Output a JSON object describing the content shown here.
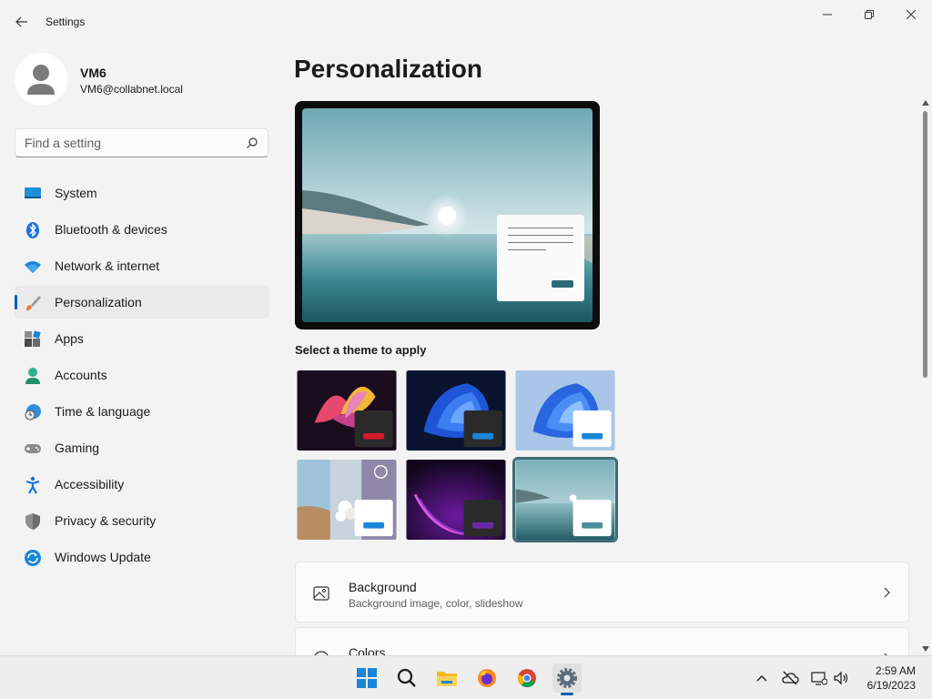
{
  "window": {
    "app_title": "Settings"
  },
  "profile": {
    "name": "VM6",
    "email": "VM6@collabnet.local"
  },
  "search": {
    "placeholder": "Find a setting"
  },
  "nav": {
    "items": [
      {
        "label": "System",
        "icon": "system-icon"
      },
      {
        "label": "Bluetooth & devices",
        "icon": "bluetooth-icon"
      },
      {
        "label": "Network & internet",
        "icon": "wifi-icon"
      },
      {
        "label": "Personalization",
        "icon": "paintbrush-icon",
        "active": true
      },
      {
        "label": "Apps",
        "icon": "apps-icon"
      },
      {
        "label": "Accounts",
        "icon": "accounts-icon"
      },
      {
        "label": "Time & language",
        "icon": "globe-clock-icon"
      },
      {
        "label": "Gaming",
        "icon": "gamepad-icon"
      },
      {
        "label": "Accessibility",
        "icon": "accessibility-icon"
      },
      {
        "label": "Privacy & security",
        "icon": "shield-icon"
      },
      {
        "label": "Windows Update",
        "icon": "update-icon"
      }
    ]
  },
  "main": {
    "title": "Personalization",
    "theme_section_label": "Select a theme to apply",
    "themes": [
      {
        "name": "glow",
        "selected": false
      },
      {
        "name": "windows-dark",
        "selected": false
      },
      {
        "name": "windows-light",
        "selected": false
      },
      {
        "name": "spotlight",
        "selected": false
      },
      {
        "name": "flow",
        "selected": false
      },
      {
        "name": "captured-motion",
        "selected": true
      }
    ],
    "cards": [
      {
        "title": "Background",
        "subtitle": "Background image, color, slideshow",
        "icon": "image-icon"
      },
      {
        "title": "Colors",
        "subtitle": "",
        "icon": "palette-icon"
      }
    ]
  },
  "taskbar": {
    "apps": [
      "start-icon",
      "search-icon",
      "file-explorer-icon",
      "firefox-icon",
      "chrome-icon",
      "settings-icon"
    ],
    "clock": {
      "time": "2:59 AM",
      "date": "6/19/2023"
    }
  },
  "colors": {
    "accent": "#005fb8",
    "background": "#f3f3f3",
    "card": "#fbfbfb"
  }
}
